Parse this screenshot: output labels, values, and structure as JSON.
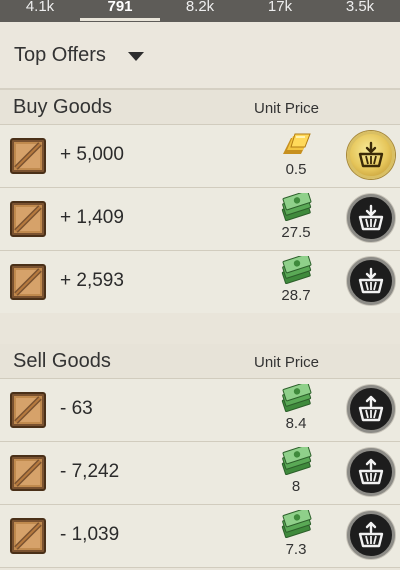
{
  "tabs": [
    {
      "label": "4.1k",
      "active": false
    },
    {
      "label": "791",
      "active": true
    },
    {
      "label": "8.2k",
      "active": false
    },
    {
      "label": "17k",
      "active": false
    },
    {
      "label": "3.5k",
      "active": false
    }
  ],
  "offers": {
    "label": "Top Offers",
    "icon": "caret-down-icon"
  },
  "buy": {
    "title": "Buy Goods",
    "unit_price_label": "Unit Price",
    "rows": [
      {
        "qty": "+ 5,000",
        "price": "0.5",
        "currency": "gold",
        "button": "buy-gold"
      },
      {
        "qty": "+ 1,409",
        "price": "27.5",
        "currency": "cash",
        "button": "buy"
      },
      {
        "qty": "+ 2,593",
        "price": "28.7",
        "currency": "cash",
        "button": "buy"
      }
    ]
  },
  "sell": {
    "title": "Sell Goods",
    "unit_price_label": "Unit Price",
    "rows": [
      {
        "qty": "- 63",
        "price": "8.4",
        "currency": "cash",
        "button": "sell"
      },
      {
        "qty": "- 7,242",
        "price": "8",
        "currency": "cash",
        "button": "sell"
      },
      {
        "qty": "- 1,039",
        "price": "7.3",
        "currency": "cash",
        "button": "sell"
      }
    ]
  },
  "colors": {
    "background": "#e9e5da",
    "topbar": "#5e5c58",
    "button_dark": "#1d1d1d",
    "button_gold": "#e6c65b",
    "cash_green": "#4e9a4a"
  }
}
